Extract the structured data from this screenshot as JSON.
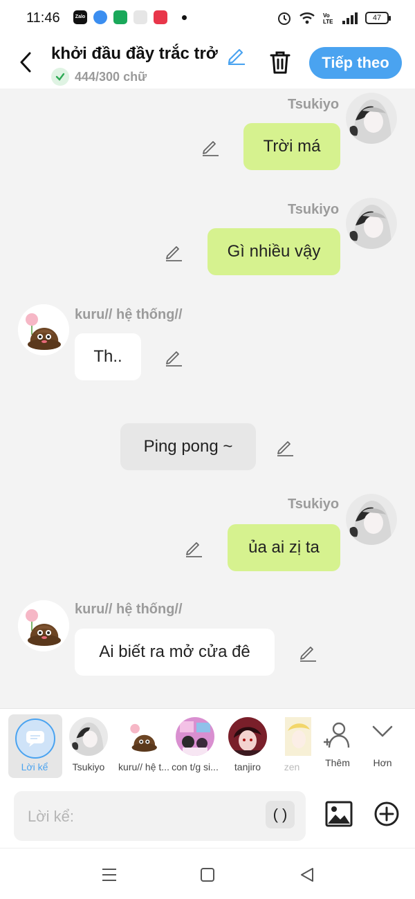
{
  "status_bar": {
    "time": "11:46",
    "battery": "47",
    "app_colors": [
      "#111111",
      "#3b8ef0",
      "#1aa85a",
      "#dddddd",
      "#e8364a"
    ]
  },
  "header": {
    "title": "khởi đầu đầy trắc trở",
    "word_count": "444/300 chữ",
    "next_label": "Tiếp theo"
  },
  "messages": [
    {
      "sender": "Tsukiyo",
      "text": "Trời má",
      "side": "right",
      "style": "green"
    },
    {
      "sender": "Tsukiyo",
      "text": "Gì nhiều vậy",
      "side": "right",
      "style": "green"
    },
    {
      "sender": "kuru// hệ thống//",
      "text": "Th..",
      "side": "left",
      "style": "white"
    },
    {
      "sender": "",
      "text": "Ping pong ~",
      "side": "center",
      "style": "narration"
    },
    {
      "sender": "Tsukiyo",
      "text": "ủa ai zị ta",
      "side": "right",
      "style": "green"
    },
    {
      "sender": "kuru// hệ thống//",
      "text": "Ai biết ra mở cửa đê",
      "side": "left",
      "style": "white"
    }
  ],
  "character_bar": {
    "narration_label": "Lời kể",
    "characters": [
      {
        "label": "Tsukiyo"
      },
      {
        "label": "kuru// hệ t..."
      },
      {
        "label": "con t/g si..."
      },
      {
        "label": "tanjiro"
      },
      {
        "label": "zen"
      }
    ],
    "add_label": "Thêm",
    "more_label": "Hơn"
  },
  "input": {
    "placeholder": "Lời kể:",
    "paren_label": "( )"
  },
  "colors": {
    "accent": "#4aa3f0",
    "green_bubble": "#d6f28f",
    "background": "#f3f3f3"
  }
}
